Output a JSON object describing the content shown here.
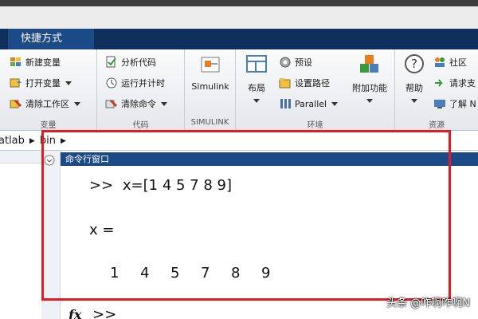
{
  "tabs": {
    "shortcuts": "快捷方式"
  },
  "ribbon": {
    "variable": {
      "new": "新建变量",
      "open": "打开变量",
      "clear": "清除工作区",
      "label": "变量"
    },
    "code": {
      "analyze": "分析代码",
      "runtime": "运行并计时",
      "clearcmd": "清除命令",
      "label": "代码"
    },
    "simulink": {
      "button": "Simulink",
      "label": "SIMULINK"
    },
    "env": {
      "layout": "布局",
      "prefs": "预设",
      "setpath": "设置路径",
      "parallel": "Parallel",
      "addons": "附加功能",
      "label": "环境"
    },
    "resources": {
      "help": "帮助",
      "community": "社区",
      "request": "请求支",
      "learn": "了解 N",
      "label": "资源"
    }
  },
  "path": {
    "seg1": "atlab",
    "seg2": "bin"
  },
  "cmd": {
    "title": "命令行窗口",
    "prompt": ">>",
    "line1": "x=[1 4 5 7 8 9]",
    "line2": "x =",
    "values": [
      "1",
      "4",
      "5",
      "7",
      "8",
      "9"
    ],
    "fx": "fx"
  },
  "watermark": "头条 @咋啊咋啊N",
  "colors": {
    "accent": "#1c4a86",
    "highlight": "#e31b23",
    "titlebar": "#0f2f5d"
  },
  "icons": [
    "new-variable-icon",
    "open-variable-icon",
    "clear-workspace-icon",
    "analyze-code-icon",
    "run-time-icon",
    "clear-commands-icon",
    "simulink-icon",
    "layout-icon",
    "preferences-icon",
    "set-path-icon",
    "parallel-icon",
    "addons-icon",
    "help-icon",
    "community-icon",
    "request-support-icon",
    "learn-icon"
  ]
}
